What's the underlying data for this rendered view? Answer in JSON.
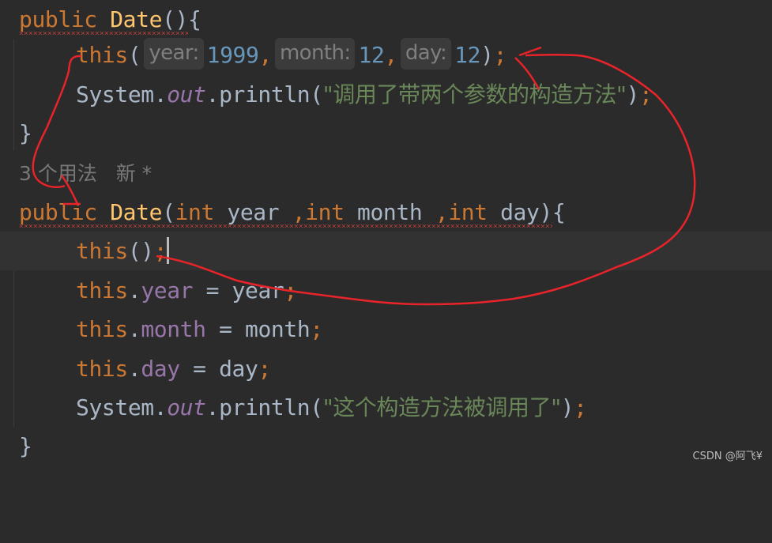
{
  "editor": {
    "theme_colors": {
      "background": "#2b2b2b",
      "current_line": "#323232",
      "keyword": "#cc7832",
      "method_decl": "#ffc66d",
      "number": "#6897bb",
      "string": "#6a8759",
      "field": "#9876aa",
      "default_text": "#a9b7c6",
      "annotation_red": "#e8242a"
    },
    "lines": [
      {
        "kw": "public",
        "name": "Date",
        "open": "()",
        "brace": "{"
      },
      {
        "this": "this",
        "open": "(",
        "hints": [
          {
            "label": "year:",
            "value": "1999",
            "sep": ","
          },
          {
            "label": "month:",
            "value": "12",
            "sep": ","
          },
          {
            "label": "day:",
            "value": "12",
            "sep": ""
          }
        ],
        "close": ")",
        "semi": ";"
      },
      {
        "cls": "System",
        "dot1": ".",
        "out": "out",
        "dot2": ".",
        "method": "println",
        "open": "(",
        "str": "\"调用了带两个参数的构造方法\"",
        "close": ")",
        "semi": ";"
      },
      {
        "brace": "}"
      },
      {
        "usages": "3 个用法",
        "new": "新 *"
      },
      {
        "kw": "public",
        "name": "Date",
        "open": "(",
        "p1t": "int",
        "p1": "year",
        "c1": ",",
        "p2t": "int",
        "p2": "month",
        "c2": ",",
        "p3t": "int",
        "p3": "day",
        "close": ")",
        "brace": "{"
      },
      {
        "this": "this",
        "call": "()",
        "semi": ";"
      },
      {
        "this": "this",
        "dot": ".",
        "field": "year",
        "eq": " = ",
        "value": "year",
        "semi": ";"
      },
      {
        "this": "this",
        "dot": ".",
        "field": "month",
        "eq": " = ",
        "value": "month",
        "semi": ";"
      },
      {
        "this": "this",
        "dot": ".",
        "field": "day",
        "eq": " = ",
        "value": "day",
        "semi": ";"
      },
      {
        "cls": "System",
        "dot1": ".",
        "out": "out",
        "dot2": ".",
        "method": "println",
        "open": "(",
        "str": "\"这个构造方法被调用了\"",
        "close": ")",
        "semi": ";"
      },
      {
        "brace": "}"
      }
    ]
  },
  "watermark": "CSDN @阿飞¥"
}
